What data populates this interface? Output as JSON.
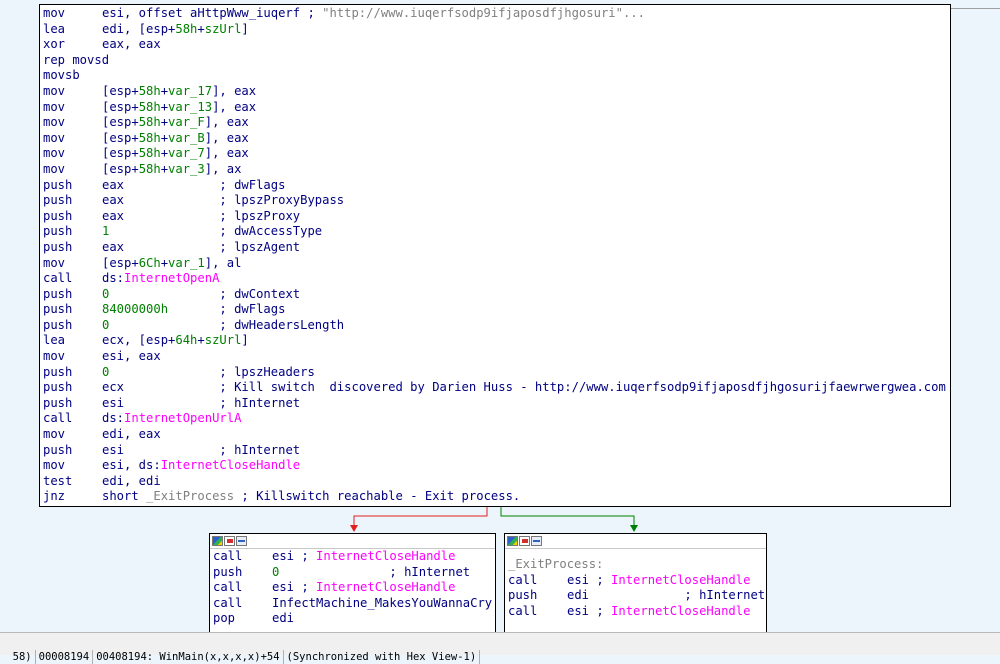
{
  "main_block": {
    "lines": [
      {
        "m": "mov",
        "o": [
          {
            "t": "esi, offset aHttpWww_iuqerf ; ",
            "c": "reg"
          },
          {
            "t": "\"http://www.iuqerfsodp9ifjaposdfjhgosuri\"...",
            "c": "str"
          }
        ]
      },
      {
        "m": "lea",
        "o": [
          {
            "t": "edi, [esp+",
            "c": "reg"
          },
          {
            "t": "58h",
            "c": "num"
          },
          {
            "t": "+",
            "c": "reg"
          },
          {
            "t": "szUrl",
            "c": "sym"
          },
          {
            "t": "]",
            "c": "reg"
          }
        ]
      },
      {
        "m": "xor",
        "o": [
          {
            "t": "eax, eax",
            "c": "reg"
          }
        ]
      },
      {
        "m": "rep movsd",
        "o": []
      },
      {
        "m": "movsb",
        "o": []
      },
      {
        "m": "mov",
        "o": [
          {
            "t": "[esp+",
            "c": "reg"
          },
          {
            "t": "58h",
            "c": "num"
          },
          {
            "t": "+",
            "c": "reg"
          },
          {
            "t": "var_17",
            "c": "sym"
          },
          {
            "t": "], eax",
            "c": "reg"
          }
        ]
      },
      {
        "m": "mov",
        "o": [
          {
            "t": "[esp+",
            "c": "reg"
          },
          {
            "t": "58h",
            "c": "num"
          },
          {
            "t": "+",
            "c": "reg"
          },
          {
            "t": "var_13",
            "c": "sym"
          },
          {
            "t": "], eax",
            "c": "reg"
          }
        ]
      },
      {
        "m": "mov",
        "o": [
          {
            "t": "[esp+",
            "c": "reg"
          },
          {
            "t": "58h",
            "c": "num"
          },
          {
            "t": "+",
            "c": "reg"
          },
          {
            "t": "var_F",
            "c": "sym"
          },
          {
            "t": "], eax",
            "c": "reg"
          }
        ]
      },
      {
        "m": "mov",
        "o": [
          {
            "t": "[esp+",
            "c": "reg"
          },
          {
            "t": "58h",
            "c": "num"
          },
          {
            "t": "+",
            "c": "reg"
          },
          {
            "t": "var_B",
            "c": "sym"
          },
          {
            "t": "], eax",
            "c": "reg"
          }
        ]
      },
      {
        "m": "mov",
        "o": [
          {
            "t": "[esp+",
            "c": "reg"
          },
          {
            "t": "58h",
            "c": "num"
          },
          {
            "t": "+",
            "c": "reg"
          },
          {
            "t": "var_7",
            "c": "sym"
          },
          {
            "t": "], eax",
            "c": "reg"
          }
        ]
      },
      {
        "m": "mov",
        "o": [
          {
            "t": "[esp+",
            "c": "reg"
          },
          {
            "t": "58h",
            "c": "num"
          },
          {
            "t": "+",
            "c": "reg"
          },
          {
            "t": "var_3",
            "c": "sym"
          },
          {
            "t": "], ax",
            "c": "reg"
          }
        ]
      },
      {
        "m": "push",
        "o": [
          {
            "t": "eax             ",
            "c": "reg"
          },
          {
            "t": "; dwFlags",
            "c": "cmt"
          }
        ]
      },
      {
        "m": "push",
        "o": [
          {
            "t": "eax             ",
            "c": "reg"
          },
          {
            "t": "; lpszProxyBypass",
            "c": "cmt"
          }
        ]
      },
      {
        "m": "push",
        "o": [
          {
            "t": "eax             ",
            "c": "reg"
          },
          {
            "t": "; lpszProxy",
            "c": "cmt"
          }
        ]
      },
      {
        "m": "push",
        "o": [
          {
            "t": "1               ",
            "c": "num"
          },
          {
            "t": "; dwAccessType",
            "c": "cmt"
          }
        ]
      },
      {
        "m": "push",
        "o": [
          {
            "t": "eax             ",
            "c": "reg"
          },
          {
            "t": "; lpszAgent",
            "c": "cmt"
          }
        ]
      },
      {
        "m": "mov",
        "o": [
          {
            "t": "[esp+",
            "c": "reg"
          },
          {
            "t": "6Ch",
            "c": "num"
          },
          {
            "t": "+",
            "c": "reg"
          },
          {
            "t": "var_1",
            "c": "sym"
          },
          {
            "t": "], al",
            "c": "reg"
          }
        ]
      },
      {
        "m": "call",
        "o": [
          {
            "t": "ds:",
            "c": "reg"
          },
          {
            "t": "InternetOpenA",
            "c": "imp"
          }
        ]
      },
      {
        "m": "push",
        "o": [
          {
            "t": "0               ",
            "c": "num"
          },
          {
            "t": "; dwContext",
            "c": "cmt"
          }
        ]
      },
      {
        "m": "push",
        "o": [
          {
            "t": "84000000h       ",
            "c": "num"
          },
          {
            "t": "; dwFlags",
            "c": "cmt"
          }
        ]
      },
      {
        "m": "push",
        "o": [
          {
            "t": "0               ",
            "c": "num"
          },
          {
            "t": "; dwHeadersLength",
            "c": "cmt"
          }
        ]
      },
      {
        "m": "lea",
        "o": [
          {
            "t": "ecx, [esp+",
            "c": "reg"
          },
          {
            "t": "64h",
            "c": "num"
          },
          {
            "t": "+",
            "c": "reg"
          },
          {
            "t": "szUrl",
            "c": "sym"
          },
          {
            "t": "]",
            "c": "reg"
          }
        ]
      },
      {
        "m": "mov",
        "o": [
          {
            "t": "esi, eax",
            "c": "reg"
          }
        ]
      },
      {
        "m": "push",
        "o": [
          {
            "t": "0               ",
            "c": "num"
          },
          {
            "t": "; lpszHeaders",
            "c": "cmt"
          }
        ]
      },
      {
        "m": "push",
        "o": [
          {
            "t": "ecx             ",
            "c": "reg"
          },
          {
            "t": "; Kill switch  discovered by Darien Huss - http://www.iuqerfsodp9ifjaposdfjhgosurijfaewrwergwea.com",
            "c": "cmt"
          }
        ]
      },
      {
        "m": "push",
        "o": [
          {
            "t": "esi             ",
            "c": "reg"
          },
          {
            "t": "; hInternet",
            "c": "cmt"
          }
        ]
      },
      {
        "m": "call",
        "o": [
          {
            "t": "ds:",
            "c": "reg"
          },
          {
            "t": "InternetOpenUrlA",
            "c": "imp"
          }
        ]
      },
      {
        "m": "mov",
        "o": [
          {
            "t": "edi, eax",
            "c": "reg"
          }
        ]
      },
      {
        "m": "push",
        "o": [
          {
            "t": "esi             ",
            "c": "reg"
          },
          {
            "t": "; hInternet",
            "c": "cmt"
          }
        ]
      },
      {
        "m": "mov",
        "o": [
          {
            "t": "esi, ds:",
            "c": "reg"
          },
          {
            "t": "InternetCloseHandle",
            "c": "imp"
          }
        ]
      },
      {
        "m": "test",
        "o": [
          {
            "t": "edi, edi",
            "c": "reg"
          }
        ]
      },
      {
        "m": "jnz",
        "o": [
          {
            "t": "short ",
            "c": "reg"
          },
          {
            "t": "_ExitProcess",
            "c": "loc"
          },
          {
            "t": " ; Killswitch reachable - Exit process.",
            "c": "cmt"
          }
        ]
      }
    ]
  },
  "left_block": {
    "lines": [
      {
        "m": "call",
        "o": [
          {
            "t": "esi ; ",
            "c": "reg"
          },
          {
            "t": "InternetCloseHandle",
            "c": "imp"
          }
        ]
      },
      {
        "m": "push",
        "o": [
          {
            "t": "0               ",
            "c": "num"
          },
          {
            "t": "; hInternet",
            "c": "cmt"
          }
        ]
      },
      {
        "m": "call",
        "o": [
          {
            "t": "esi ; ",
            "c": "reg"
          },
          {
            "t": "InternetCloseHandle",
            "c": "imp"
          }
        ]
      },
      {
        "m": "call",
        "o": [
          {
            "t": "InfectMachine_MakesYouWannaCry",
            "c": "reg"
          }
        ]
      },
      {
        "m": "pop",
        "o": [
          {
            "t": "edi",
            "c": "reg"
          }
        ]
      }
    ]
  },
  "right_block": {
    "label": "_ExitProcess:",
    "lines": [
      {
        "m": "call",
        "o": [
          {
            "t": "esi ; ",
            "c": "reg"
          },
          {
            "t": "InternetCloseHandle",
            "c": "imp"
          }
        ]
      },
      {
        "m": "push",
        "o": [
          {
            "t": "edi             ",
            "c": "reg"
          },
          {
            "t": "; hInternet",
            "c": "cmt"
          }
        ]
      },
      {
        "m": "call",
        "o": [
          {
            "t": "esi ; ",
            "c": "reg"
          },
          {
            "t": "InternetCloseHandle",
            "c": "imp"
          }
        ]
      }
    ]
  },
  "statusbar": {
    "cells": [
      "58)",
      "00008194",
      "00408194: WinMain(x,x,x,x)+54",
      "(Synchronized with Hex View-1)"
    ]
  },
  "colors": {
    "false_edge": "#e02020",
    "true_edge": "#008000"
  }
}
